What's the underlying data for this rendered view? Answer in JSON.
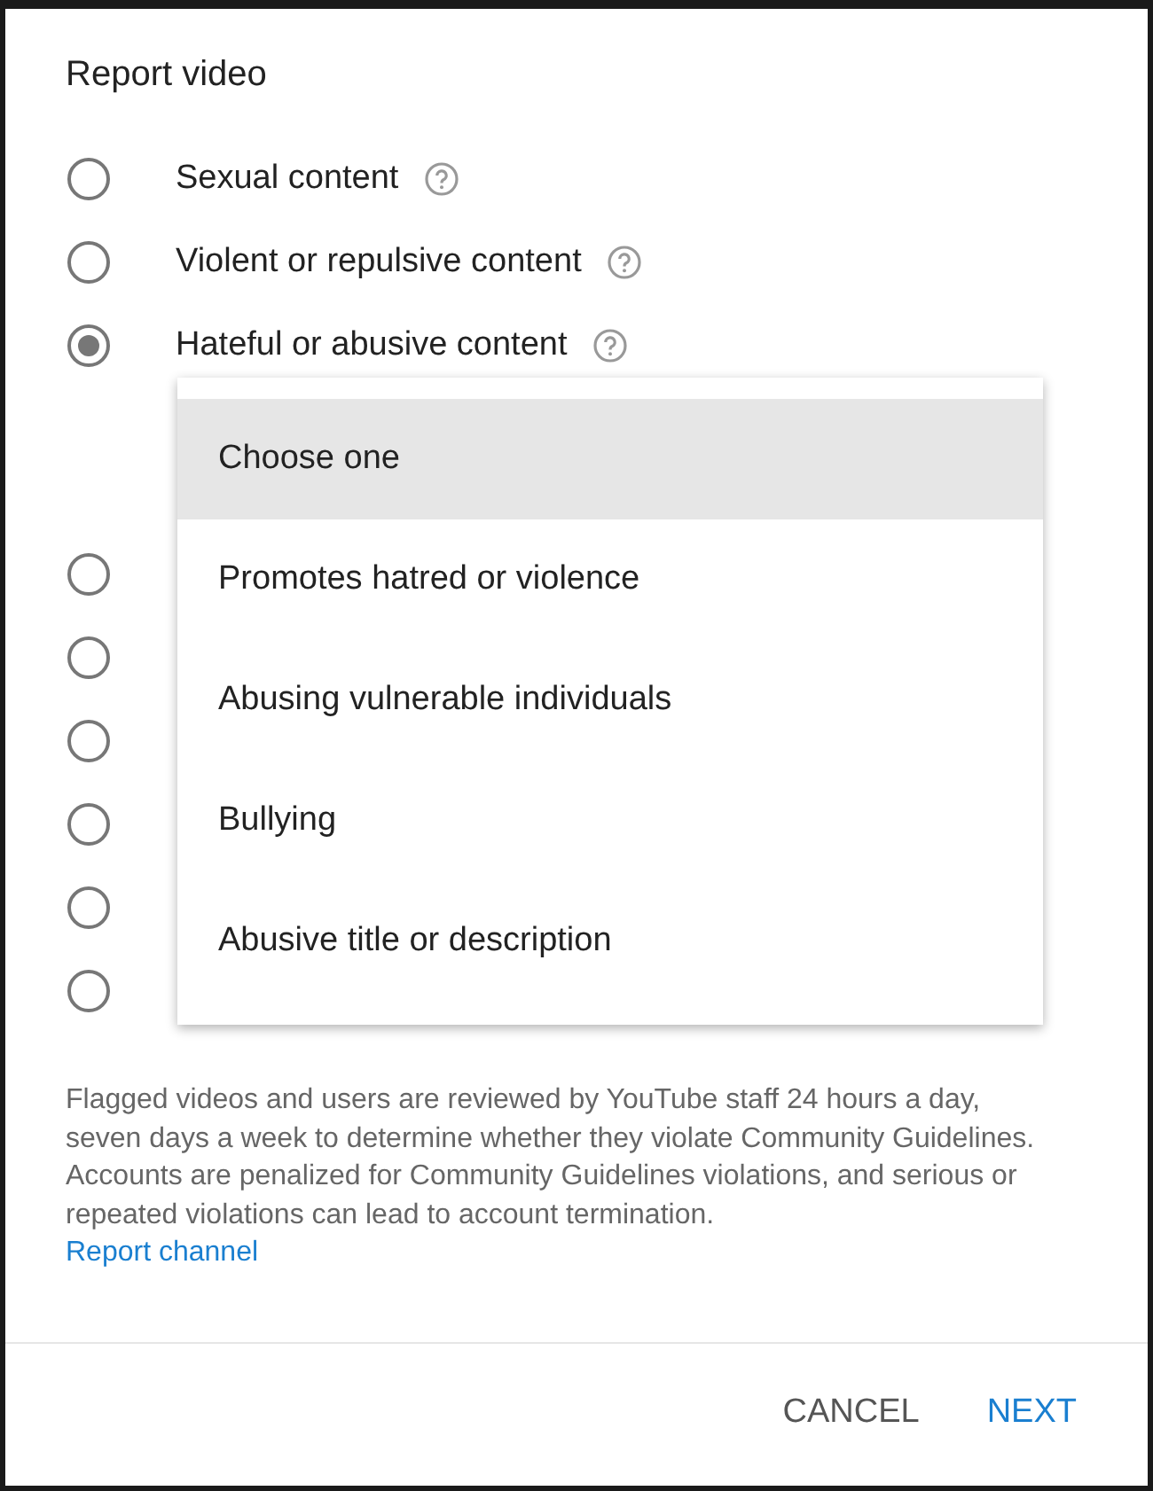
{
  "dialog": {
    "title": "Report video"
  },
  "options": [
    {
      "label": "Sexual content",
      "help": true,
      "selected": false
    },
    {
      "label": "Violent or repulsive content",
      "help": true,
      "selected": false
    },
    {
      "label": "Hateful or abusive content",
      "help": true,
      "selected": true
    },
    {
      "selected": false
    },
    {
      "selected": false
    },
    {
      "selected": false
    },
    {
      "selected": false
    },
    {
      "selected": false
    },
    {
      "selected": false
    }
  ],
  "dropdown": {
    "items": [
      {
        "label": "Choose one",
        "selected": true
      },
      {
        "label": "Promotes hatred or violence",
        "selected": false
      },
      {
        "label": "Abusing vulnerable individuals",
        "selected": false
      },
      {
        "label": "Bullying",
        "selected": false
      },
      {
        "label": "Abusive title or description",
        "selected": false
      }
    ]
  },
  "notice": "Flagged videos and users are reviewed by YouTube staff 24 hours a day, seven days a week to determine whether they violate Community Guidelines. Accounts are penalized for Community Guidelines violations, and serious or repeated violations can lead to account termination.",
  "link": "Report channel",
  "buttons": [
    {
      "label": "CANCEL",
      "kind": "secondary"
    },
    {
      "label": "NEXT",
      "kind": "primary"
    }
  ]
}
